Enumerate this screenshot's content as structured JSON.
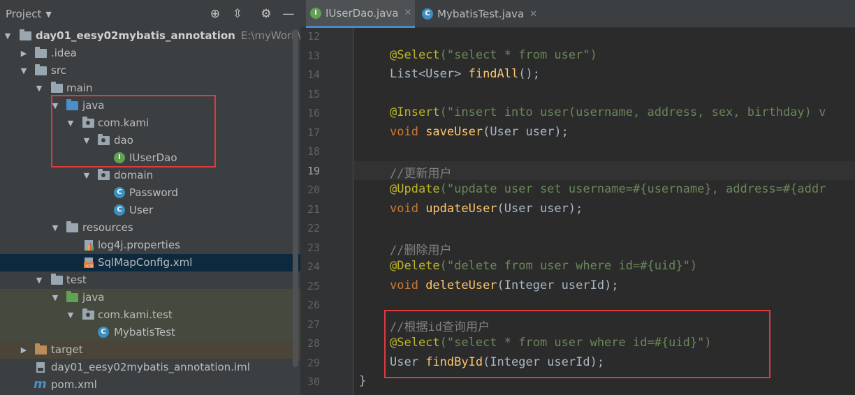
{
  "project_panel": {
    "title": "Project",
    "tree": [
      {
        "label": "day01_eesy02mybatis_annotation",
        "path": "E:\\myWork\\Wor"
      },
      {
        "label": ".idea"
      },
      {
        "label": "src"
      },
      {
        "label": "main"
      },
      {
        "label": "java"
      },
      {
        "label": "com.kami"
      },
      {
        "label": "dao"
      },
      {
        "label": "IUserDao"
      },
      {
        "label": "domain"
      },
      {
        "label": "Password"
      },
      {
        "label": "User"
      },
      {
        "label": "resources"
      },
      {
        "label": "log4j.properties"
      },
      {
        "label": "SqlMapConfig.xml"
      },
      {
        "label": "test"
      },
      {
        "label": "java"
      },
      {
        "label": "com.kami.test"
      },
      {
        "label": "MybatisTest"
      },
      {
        "label": "target"
      },
      {
        "label": "day01_eesy02mybatis_annotation.iml"
      },
      {
        "label": "pom.xml"
      }
    ]
  },
  "tabs": [
    {
      "label": "IUserDao.java",
      "icon": "I",
      "close": "✕",
      "active": true
    },
    {
      "label": "MybatisTest.java",
      "icon": "C",
      "close": "✕",
      "active": false
    }
  ],
  "line_numbers": [
    "12",
    "13",
    "14",
    "15",
    "16",
    "17",
    "18",
    "19",
    "20",
    "21",
    "22",
    "23",
    "24",
    "25",
    "26",
    "27",
    "28",
    "29",
    "30"
  ],
  "code": {
    "l13": {
      "ann": "@Select",
      "str": "(\"select * from user\")"
    },
    "l14": {
      "type": "List<User> ",
      "fn": "findAll",
      "rest": "();"
    },
    "l16": {
      "ann": "@Insert",
      "str": "(\"insert into user(username, address, sex, birthday) v"
    },
    "l17": {
      "kw": "void ",
      "fn": "saveUser",
      "rest": "(User user);"
    },
    "l19": {
      "comment": "//更新用户"
    },
    "l20": {
      "ann": "@Update",
      "str": "(\"update user set username=#{username}, address=#{addr"
    },
    "l21": {
      "kw": "void ",
      "fn": "updateUser",
      "rest": "(User user);"
    },
    "l23": {
      "comment": "//删除用户"
    },
    "l24": {
      "ann": "@Delete",
      "str": "(\"delete from user where id=#{uid}\")"
    },
    "l25": {
      "kw": "void ",
      "fn": "deleteUser",
      "rest": "(Integer userId);"
    },
    "l27": {
      "comment": "//根据id查询用户"
    },
    "l28": {
      "ann": "@Select",
      "str": "(\"select * from user where id=#{uid}\")"
    },
    "l29": {
      "type": "User ",
      "fn": "findById",
      "rest": "(Integer userId);"
    },
    "l30": {
      "rest": "}"
    }
  },
  "colors": {
    "highlight_box": "#e0393e",
    "active_tab_underline": "#4a88c7"
  }
}
